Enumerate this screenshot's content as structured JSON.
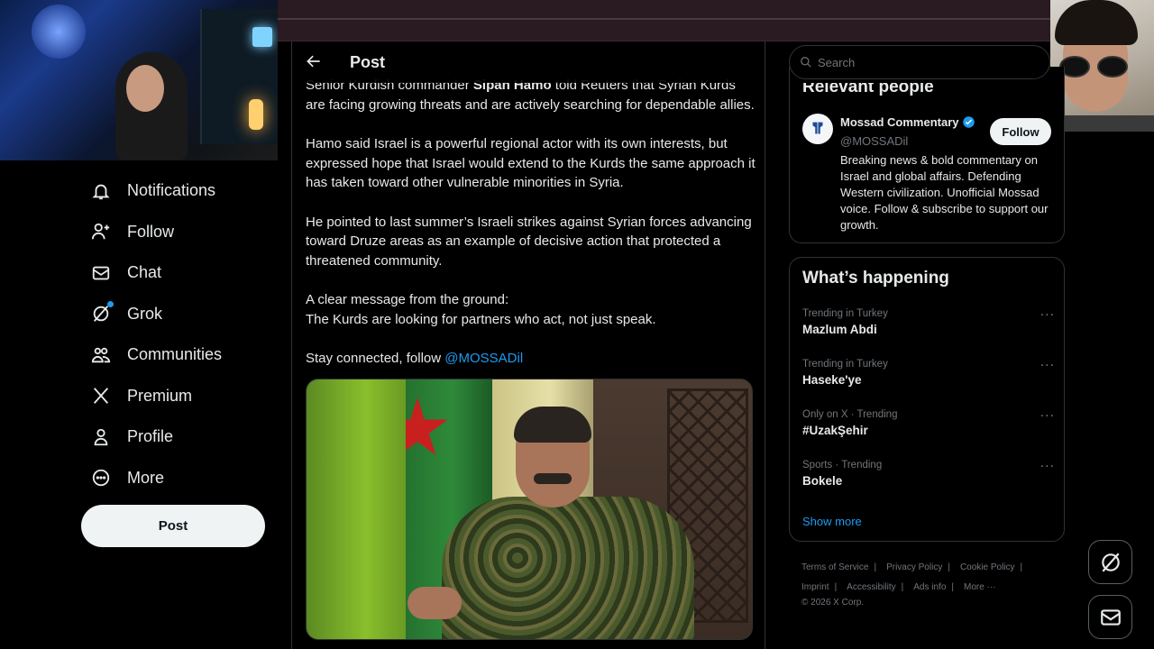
{
  "nav": {
    "items": [
      {
        "label": "Notifications",
        "icon": "bell-icon"
      },
      {
        "label": "Follow",
        "icon": "person-plus-icon"
      },
      {
        "label": "Chat",
        "icon": "envelope-icon"
      },
      {
        "label": "Grok",
        "icon": "grok-icon"
      },
      {
        "label": "Communities",
        "icon": "people-icon"
      },
      {
        "label": "Premium",
        "icon": "x-logo-icon"
      },
      {
        "label": "Profile",
        "icon": "person-icon"
      },
      {
        "label": "More",
        "icon": "more-circle-icon"
      }
    ],
    "post_button": "Post"
  },
  "main": {
    "header_title": "Post",
    "paragraphs": {
      "p1_pre": "Senior Kurdish commander ",
      "p1_bold": "Sipan Hamo",
      "p1_post": " told Reuters that Syrian Kurds are facing growing threats and are actively searching for dependable allies.",
      "p2": "Hamo said Israel is a powerful regional actor with its own interests, but expressed hope that Israel would extend to the Kurds the same approach it has taken toward other vulnerable minorities in Syria.",
      "p3": "He pointed to last summer’s Israeli strikes against Syrian forces advancing toward Druze areas as an example of decisive action that protected a threatened community.",
      "p4_line1": "A clear message from the ground:",
      "p4_line2": "The Kurds are looking for partners who act, not just speak.",
      "p5_pre": "Stay connected, follow ",
      "p5_mention": "@MOSSADil"
    }
  },
  "search": {
    "placeholder": "Search"
  },
  "relevant": {
    "title": "Relevant people",
    "name": "Mossad Commentary",
    "handle": "@MOSSADil",
    "bio": "Breaking news & bold commentary on Israel and global affairs. Defending Western civilization. Unofficial Mossad voice. Follow & subscribe to support our growth.",
    "follow_label": "Follow",
    "verified_color": "#1d9bf0"
  },
  "happening": {
    "title": "What’s happening",
    "trends": [
      {
        "meta": "Trending in Turkey",
        "name": "Mazlum Abdi"
      },
      {
        "meta": "Trending in Turkey",
        "name": "Haseke'ye"
      },
      {
        "meta": "Only on X · Trending",
        "name": "#UzakŞehir"
      },
      {
        "meta": "Sports · Trending",
        "name": "Bokele"
      }
    ],
    "show_more": "Show more"
  },
  "footer": {
    "links": [
      "Terms of Service",
      "Privacy Policy",
      "Cookie Policy",
      "Imprint",
      "Accessibility",
      "Ads info",
      "More ···"
    ],
    "copyright": "© 2026 X Corp."
  },
  "colors": {
    "accent": "#1d9bf0",
    "background": "#000000",
    "text": "#e7e9ea",
    "muted": "#71767b",
    "border": "#2f3336"
  }
}
